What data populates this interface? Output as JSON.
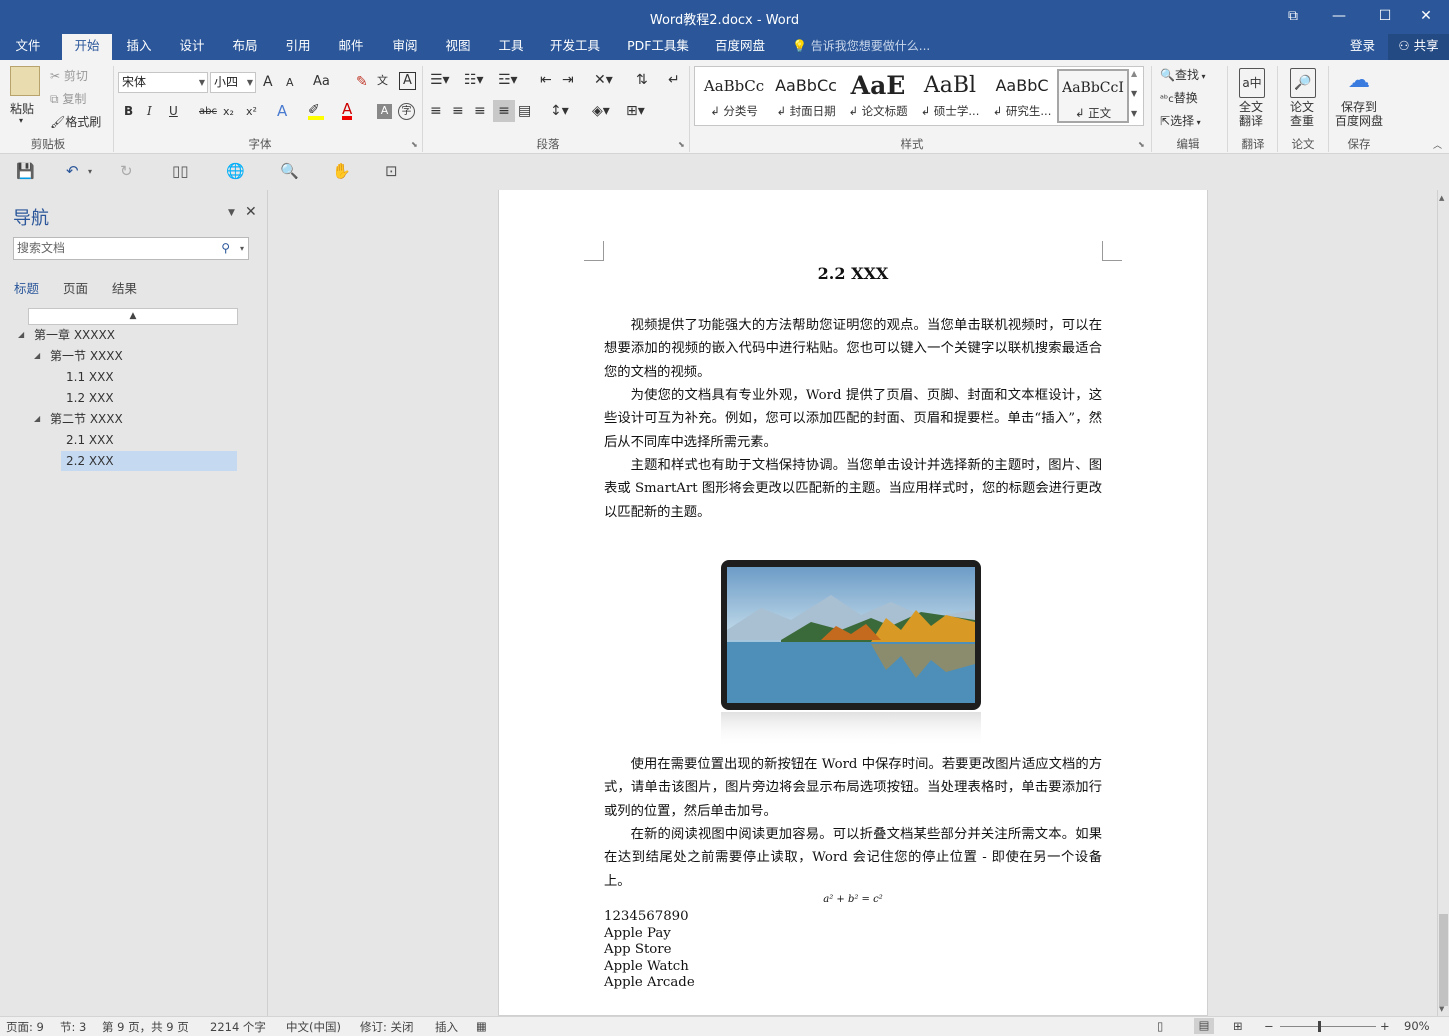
{
  "window": {
    "title": "Word教程2.docx - Word",
    "controls": [
      "⧉",
      "—",
      "☐",
      "✕"
    ]
  },
  "menu": {
    "tabs": [
      "文件",
      "开始",
      "插入",
      "设计",
      "布局",
      "引用",
      "邮件",
      "审阅",
      "视图",
      "工具",
      "开发工具",
      "PDF工具集",
      "百度网盘"
    ],
    "active_tab": "开始",
    "tell_me": "告诉我您想要做什么...",
    "login": "登录",
    "share": "共享"
  },
  "ribbon": {
    "clipboard": {
      "paste": "粘贴",
      "cut": "剪切",
      "copy": "复制",
      "format_painter": "格式刷",
      "label": "剪贴板"
    },
    "font": {
      "name": "宋体",
      "size": "小四",
      "label": "字体",
      "grow": "A",
      "shrink": "A",
      "case": "Aa",
      "bold": "B",
      "italic": "I",
      "underline": "U",
      "strike": "abc",
      "sub": "x₂",
      "sup": "x²",
      "text_effect": "A",
      "font_color": "A"
    },
    "paragraph": {
      "label": "段落"
    },
    "styles": {
      "label": "样式",
      "items": [
        {
          "preview": "AaBbCc",
          "name": "↲ 分类号"
        },
        {
          "preview": "AaBbCc",
          "name": "↲ 封面日期"
        },
        {
          "preview": "AaE",
          "name": "↲ 论文标题"
        },
        {
          "preview": "AaBl",
          "name": "↲ 硕士学..."
        },
        {
          "preview": "AaBbC",
          "name": "↲ 研究生..."
        },
        {
          "preview": "AaBbCcI",
          "name": "↲ 正文"
        }
      ]
    },
    "editing": {
      "find": "查找",
      "replace": "替换",
      "select": "选择",
      "label": "编辑"
    },
    "translate": {
      "button": "全文\n翻译",
      "line1": "全文",
      "line2": "翻译",
      "label": "翻译"
    },
    "paper": {
      "line1": "论文",
      "line2": "查重",
      "label": "论文"
    },
    "save": {
      "line1": "保存到",
      "line2": "百度网盘",
      "label": "保存"
    }
  },
  "nav": {
    "title": "导航",
    "search_placeholder": "搜索文档",
    "tabs": [
      "标题",
      "页面",
      "结果"
    ],
    "tree": [
      {
        "label": "第一章 XXXXX",
        "level": 0,
        "expanded": true
      },
      {
        "label": "第一节 XXXX",
        "level": 1,
        "expanded": true
      },
      {
        "label": "1.1 XXX",
        "level": 2
      },
      {
        "label": "1.2 XXX",
        "level": 2
      },
      {
        "label": "第二节 XXXX",
        "level": 1,
        "expanded": true
      },
      {
        "label": "2.1 XXX",
        "level": 2
      },
      {
        "label": "2.2 XXX",
        "level": 2,
        "selected": true
      }
    ]
  },
  "document": {
    "heading": "2.2 XXX",
    "paragraphs": [
      "视频提供了功能强大的方法帮助您证明您的观点。当您单击联机视频时，可以在想要添加的视频的嵌入代码中进行粘贴。您也可以键入一个关键字以联机搜索最适合您的文档的视频。",
      "为使您的文档具有专业外观，Word 提供了页眉、页脚、封面和文本框设计，这些设计可互为补充。例如，您可以添加匹配的封面、页眉和提要栏。单击“插入”，然后从不同库中选择所需元素。",
      "主题和样式也有助于文档保持协调。当您单击设计并选择新的主题时，图片、图表或 SmartArt 图形将会更改以匹配新的主题。当应用样式时，您的标题会进行更改以匹配新的主题。",
      "使用在需要位置出现的新按钮在 Word 中保存时间。若要更改图片适应文档的方式，请单击该图片，图片旁边将会显示布局选项按钮。当处理表格时，单击要添加行或列的位置，然后单击加号。",
      "在新的阅读视图中阅读更加容易。可以折叠文档某些部分并关注所需文本。如果在达到结尾处之前需要停止读取，Word 会记住您的停止位置 - 即使在另一个设备上。"
    ],
    "equation": "a² + b² = c²",
    "lines": [
      "1234567890",
      "Apple Pay",
      "App Store",
      "Apple Watch",
      "Apple Arcade"
    ]
  },
  "status": {
    "page": "页面: 9",
    "section": "节: 3",
    "page_of": "第 9 页，共 9 页",
    "words": "2214 个字",
    "language": "中文(中国)",
    "track": "修订: 关闭",
    "insert": "插入",
    "zoom": "90%"
  }
}
